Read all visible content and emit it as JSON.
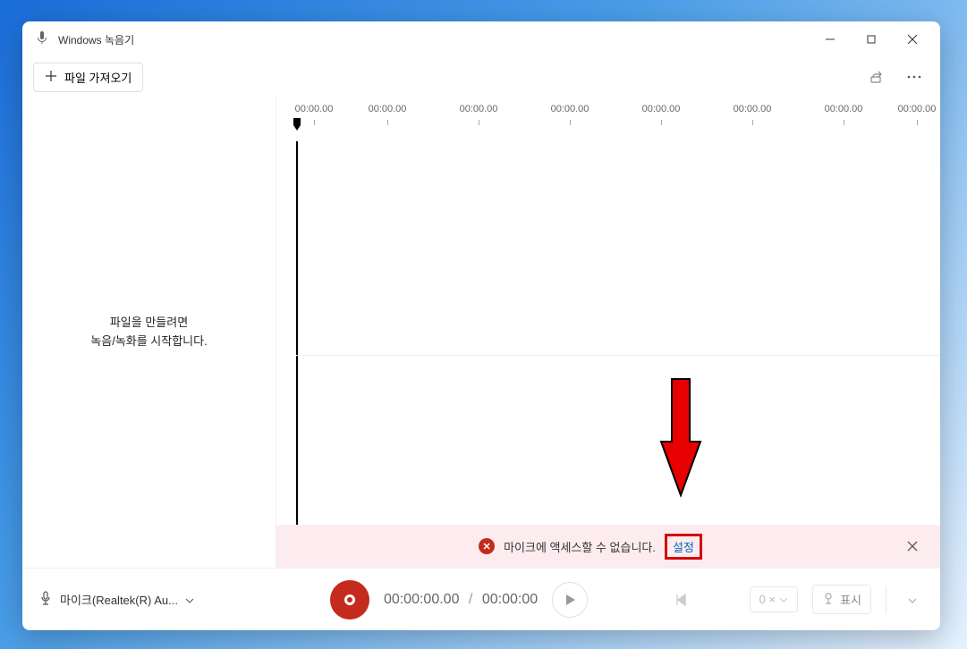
{
  "title": "Windows 녹음기",
  "toolbar": {
    "import_label": "파일 가져오기"
  },
  "sidebar": {
    "empty_line1": "파일을 만들려면",
    "empty_line2": "녹음/녹화를 시작합니다."
  },
  "timeline": {
    "ticks": [
      "00:00.00",
      "00:00.00",
      "00:00.00",
      "00:00.00",
      "00:00.00",
      "00:00.00",
      "00:00.00",
      "00:00.00"
    ]
  },
  "error": {
    "message": "마이크에 액세스할 수 없습니다.",
    "link": "설정"
  },
  "bottombar": {
    "mic_label": "마이크(Realtek(R) Au...",
    "time_current": "00:00:00.00",
    "time_total": "00:00:00",
    "speed": "0 ×",
    "marker_label": "표시"
  }
}
